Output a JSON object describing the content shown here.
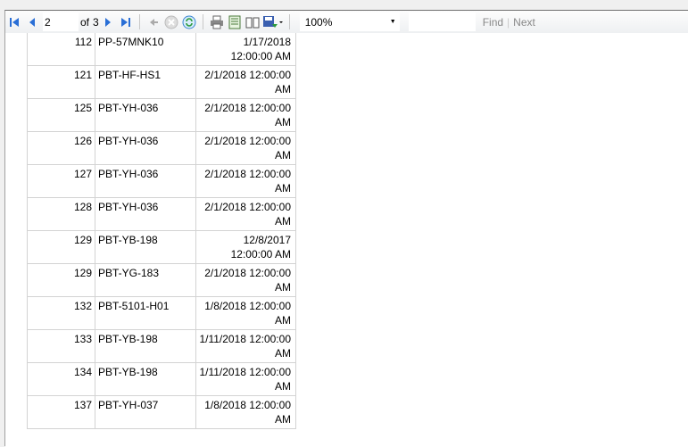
{
  "toolbar": {
    "page_current": "2",
    "page_of": "of",
    "page_total": "3",
    "zoom": "100%",
    "find_value": "",
    "find_label": "Find",
    "next_label": "Next",
    "icons": [
      "first-page-icon",
      "previous-page-icon",
      "next-page-icon",
      "last-page-icon",
      "back-icon",
      "stop-icon",
      "refresh-icon",
      "print-icon",
      "print-layout-icon",
      "page-setup-icon",
      "export-icon"
    ]
  },
  "rows": [
    {
      "num": "",
      "code": "",
      "date": "12:00:00 AM"
    },
    {
      "num": "112",
      "code": "PP-57MNK10",
      "date": "1/17/2018 12:00:00 AM"
    },
    {
      "num": "121",
      "code": "PBT-HF-HS1",
      "date": "2/1/2018 12:00:00 AM"
    },
    {
      "num": "125",
      "code": "PBT-YH-036",
      "date": "2/1/2018 12:00:00 AM"
    },
    {
      "num": "126",
      "code": "PBT-YH-036",
      "date": "2/1/2018 12:00:00 AM"
    },
    {
      "num": "127",
      "code": "PBT-YH-036",
      "date": "2/1/2018 12:00:00 AM"
    },
    {
      "num": "128",
      "code": "PBT-YH-036",
      "date": "2/1/2018 12:00:00 AM"
    },
    {
      "num": "129",
      "code": "PBT-YB-198",
      "date": "12/8/2017 12:00:00 AM"
    },
    {
      "num": "129",
      "code": "PBT-YG-183",
      "date": "2/1/2018 12:00:00 AM"
    },
    {
      "num": "132",
      "code": "PBT-5101-H01",
      "date": "1/8/2018 12:00:00 AM"
    },
    {
      "num": "133",
      "code": "PBT-YB-198",
      "date": "1/11/2018 12:00:00 AM"
    },
    {
      "num": "134",
      "code": "PBT-YB-198",
      "date": "1/11/2018 12:00:00 AM"
    },
    {
      "num": "137",
      "code": "PBT-YH-037",
      "date": "1/8/2018 12:00:00 AM"
    }
  ]
}
